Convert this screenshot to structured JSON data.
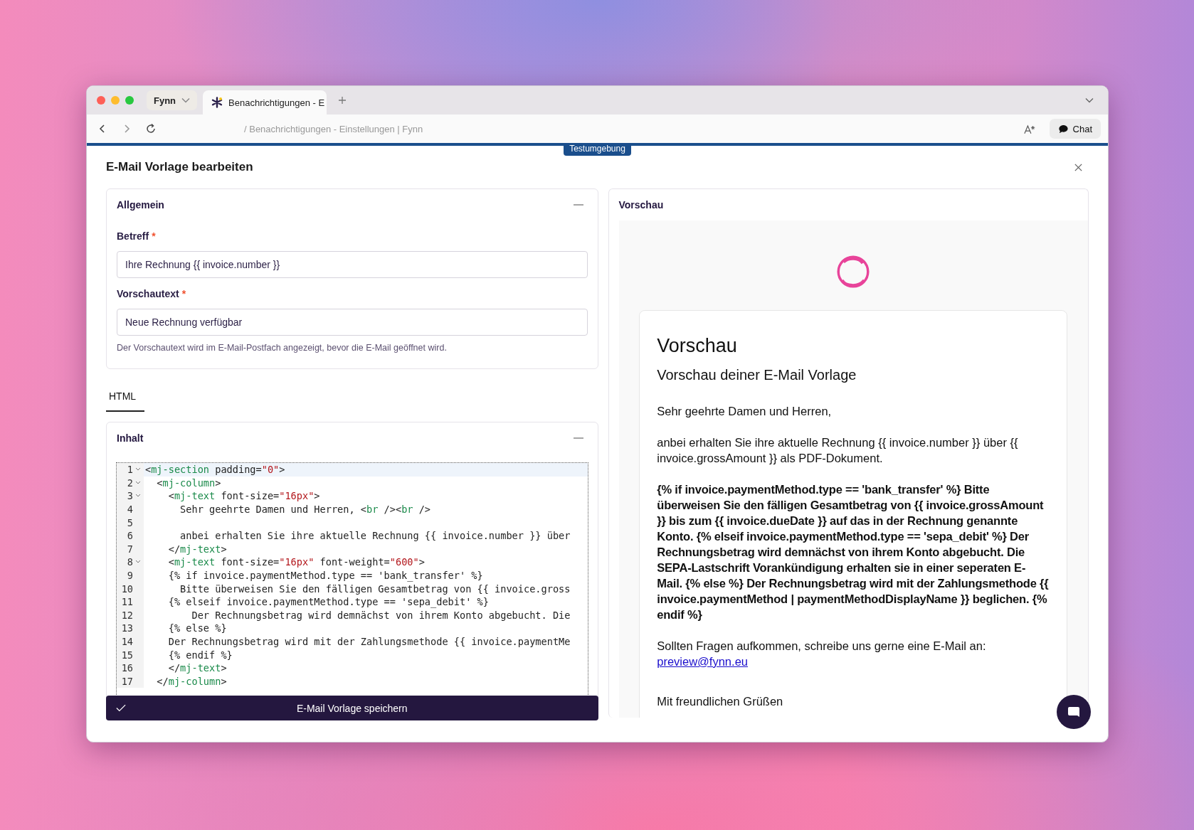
{
  "browser": {
    "profile": "Fynn",
    "tabs": [
      {
        "title": "Benachrichtigungen - E",
        "selected": true
      }
    ],
    "address": "/ Benachrichtigungen - Einstellungen | Fynn",
    "chat_button": "Chat",
    "environment_badge": "Testumgebung"
  },
  "dialog": {
    "title": "E-Mail Vorlage bearbeiten",
    "general": {
      "title": "Allgemein",
      "expanded": true,
      "fields": [
        {
          "label": "Betreff",
          "required_mark": "*",
          "value": "Ihre Rechnung {{ invoice.number }}"
        },
        {
          "label": "Vorschautext",
          "required_mark": "*",
          "value": "Neue Rechnung verfügbar",
          "help": "Der Vorschautext wird im E-Mail-Postfach angezeigt, bevor die E-Mail geöffnet wird."
        }
      ]
    },
    "editor_tabs": [
      {
        "label": "HTML",
        "selected": true
      }
    ],
    "content": {
      "title": "Inhalt",
      "expanded": true,
      "lines": [
        {
          "number": "1",
          "fold": true,
          "active": true,
          "tokens": [
            {
              "kind": "punct",
              "text": "<"
            },
            {
              "kind": "tag",
              "text": "mj-section"
            },
            {
              "kind": "attr",
              "text": " padding="
            },
            {
              "kind": "string",
              "text": "\"0\""
            },
            {
              "kind": "punct",
              "text": ">"
            }
          ]
        },
        {
          "number": "2",
          "fold": true,
          "active": false,
          "tokens": [
            {
              "kind": "punct",
              "text": "  <"
            },
            {
              "kind": "tag",
              "text": "mj-column"
            },
            {
              "kind": "punct",
              "text": ">"
            }
          ]
        },
        {
          "number": "3",
          "fold": true,
          "active": false,
          "tokens": [
            {
              "kind": "punct",
              "text": "    <"
            },
            {
              "kind": "tag",
              "text": "mj-text"
            },
            {
              "kind": "attr",
              "text": " font-size="
            },
            {
              "kind": "string",
              "text": "\"16px\""
            },
            {
              "kind": "punct",
              "text": ">"
            }
          ]
        },
        {
          "number": "4",
          "fold": false,
          "active": false,
          "tokens": [
            {
              "kind": "text",
              "text": "      Sehr geehrte Damen und Herren, <"
            },
            {
              "kind": "tag",
              "text": "br"
            },
            {
              "kind": "text",
              "text": " /><"
            },
            {
              "kind": "tag",
              "text": "br"
            },
            {
              "kind": "text",
              "text": " />"
            }
          ]
        },
        {
          "number": "5",
          "fold": false,
          "active": false
        },
        {
          "number": "6",
          "fold": false,
          "active": false,
          "tokens": [
            {
              "kind": "text",
              "text": "      anbei erhalten Sie ihre aktuelle Rechnung {{ invoice.number }} über"
            }
          ]
        },
        {
          "number": "7",
          "fold": false,
          "active": false,
          "tokens": [
            {
              "kind": "punct",
              "text": "    </"
            },
            {
              "kind": "tag",
              "text": "mj-text"
            },
            {
              "kind": "punct",
              "text": ">"
            }
          ]
        },
        {
          "number": "8",
          "fold": true,
          "active": false,
          "tokens": [
            {
              "kind": "punct",
              "text": "    <"
            },
            {
              "kind": "tag",
              "text": "mj-text"
            },
            {
              "kind": "attr",
              "text": " font-size="
            },
            {
              "kind": "string",
              "text": "\"16px\""
            },
            {
              "kind": "attr",
              "text": " font-weight="
            },
            {
              "kind": "string",
              "text": "\"600\""
            },
            {
              "kind": "punct",
              "text": ">"
            }
          ]
        },
        {
          "number": "9",
          "fold": false,
          "active": false,
          "tokens": [
            {
              "kind": "text",
              "text": "    {% if invoice.paymentMethod.type == 'bank_transfer' %}"
            }
          ]
        },
        {
          "number": "10",
          "fold": false,
          "active": false,
          "tokens": [
            {
              "kind": "text",
              "text": "      Bitte überweisen Sie den fälligen Gesamtbetrag von {{ invoice.gross"
            }
          ]
        },
        {
          "number": "11",
          "fold": false,
          "active": false,
          "tokens": [
            {
              "kind": "text",
              "text": "    {% elseif invoice.paymentMethod.type == 'sepa_debit' %}"
            }
          ]
        },
        {
          "number": "12",
          "fold": false,
          "active": false,
          "tokens": [
            {
              "kind": "text",
              "text": "        Der Rechnungsbetrag wird demnächst von ihrem Konto abgebucht. Die"
            }
          ]
        },
        {
          "number": "13",
          "fold": false,
          "active": false,
          "tokens": [
            {
              "kind": "text",
              "text": "    {% else %}"
            }
          ]
        },
        {
          "number": "14",
          "fold": false,
          "active": false,
          "tokens": [
            {
              "kind": "text",
              "text": "    Der Rechnungsbetrag wird mit der Zahlungsmethode {{ invoice.paymentMe"
            }
          ]
        },
        {
          "number": "15",
          "fold": false,
          "active": false,
          "tokens": [
            {
              "kind": "text",
              "text": "    {% endif %}"
            }
          ]
        },
        {
          "number": "16",
          "fold": false,
          "active": false,
          "tokens": [
            {
              "kind": "punct",
              "text": "    </"
            },
            {
              "kind": "tag",
              "text": "mj-text"
            },
            {
              "kind": "punct",
              "text": ">"
            }
          ]
        },
        {
          "number": "17",
          "fold": false,
          "active": false,
          "tokens": [
            {
              "kind": "punct",
              "text": "  </"
            },
            {
              "kind": "tag",
              "text": "mj-column"
            },
            {
              "kind": "punct",
              "text": ">"
            }
          ]
        }
      ]
    },
    "save_button": "E-Mail Vorlage speichern",
    "preview": {
      "title": "Vorschau",
      "email_title": "Vorschau",
      "email_subtitle": "Vorschau deiner E-Mail Vorlage",
      "paragraphs": [
        {
          "kind": "text",
          "text": "Sehr geehrte Damen und Herren,"
        },
        {
          "kind": "text",
          "text": "anbei erhalten Sie ihre aktuelle Rechnung {{ invoice.number }} über {{ invoice.grossAmount }} als PDF-Dokument."
        },
        {
          "kind": "bold",
          "text": "{% if invoice.paymentMethod.type == 'bank_transfer' %} Bitte überweisen Sie den fälligen Gesamtbetrag von {{ invoice.grossAmount }} bis zum {{ invoice.dueDate }} auf das in der Rechnung genannte Konto. {% elseif invoice.paymentMethod.type == 'sepa_debit' %} Der Rechnungsbetrag wird demnächst von ihrem Konto abgebucht. Die SEPA-Lastschrift Vorankündigung erhalten sie in einer seperaten E-Mail. {% else %} Der Rechnungsbetrag wird mit der Zahlungsmethode {{ invoice.paymentMethod | paymentMethodDisplayName }} beglichen. {% endif %}"
        },
        {
          "kind": "contact",
          "text": "Sollten Fragen aufkommen, schreibe uns gerne eine E-Mail an:",
          "link": "preview@fynn.eu"
        },
        {
          "kind": "closing",
          "text": "Mit freundlichen Grüßen"
        }
      ]
    }
  }
}
